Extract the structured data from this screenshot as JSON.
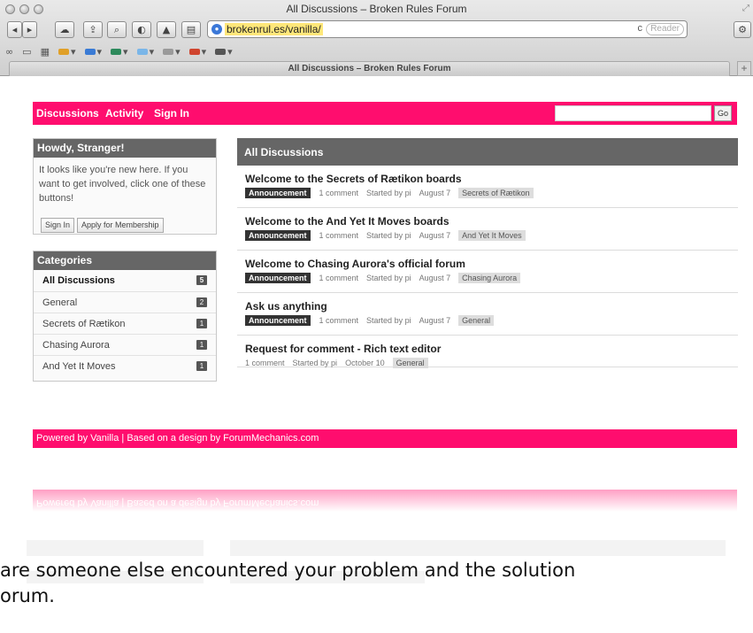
{
  "window": {
    "title": "All Discussions – Broken Rules Forum",
    "tab_title": "All Discussions – Broken Rules Forum",
    "url": "brokenrul.es/vanilla/",
    "reader_label": "Reader",
    "reload_glyph": "c"
  },
  "toolbar": {
    "buttons": [
      "back-icon",
      "forward-icon",
      "icloud-icon",
      "share-icon",
      "zoom-icon",
      "history-icon",
      "alert-icon",
      "sidebar-icon"
    ]
  },
  "bookmarks": {
    "items": [
      {
        "icon": "reading-list-icon",
        "color": "#777777"
      },
      {
        "icon": "book-icon",
        "color": "#777777"
      },
      {
        "icon": "grid-icon",
        "color": "#777777"
      },
      {
        "icon": "folder-icon",
        "color": "#e0a028"
      },
      {
        "icon": "folder-icon",
        "color": "#3a7bd5"
      },
      {
        "icon": "folder-icon",
        "color": "#2d8a5c"
      },
      {
        "icon": "folder-icon",
        "color": "#7ab6e8"
      },
      {
        "icon": "folder-icon",
        "color": "#9a9a9a"
      },
      {
        "icon": "folder-icon",
        "color": "#d0452f"
      },
      {
        "icon": "folder-icon",
        "color": "#555555"
      }
    ]
  },
  "nav": {
    "discussions": "Discussions",
    "activity": "Activity",
    "sign_in": "Sign In",
    "go": "Go",
    "accent": "#ff0d6e"
  },
  "howdy": {
    "heading": "Howdy, Stranger!",
    "text": "It looks like you're new here. If you want to get involved, click one of these buttons!",
    "sign_in": "Sign In",
    "apply": "Apply for Membership"
  },
  "categories": {
    "heading": "Categories",
    "items": [
      {
        "label": "All Discussions",
        "count": "5"
      },
      {
        "label": "General",
        "count": "2"
      },
      {
        "label": "Secrets of Rætikon",
        "count": "1"
      },
      {
        "label": "Chasing Aurora",
        "count": "1"
      },
      {
        "label": "And Yet It Moves",
        "count": "1"
      }
    ]
  },
  "discussions": {
    "heading": "All Discussions",
    "items": [
      {
        "title": "Welcome to the Secrets of Rætikon boards",
        "badge": "Announcement",
        "comments": "1 comment",
        "started": "Started by pi",
        "date": "August 7",
        "category": "Secrets of Rætikon"
      },
      {
        "title": "Welcome to the And Yet It Moves boards",
        "badge": "Announcement",
        "comments": "1 comment",
        "started": "Started by pi",
        "date": "August 7",
        "category": "And Yet It Moves"
      },
      {
        "title": "Welcome to Chasing Aurora's official forum",
        "badge": "Announcement",
        "comments": "1 comment",
        "started": "Started by pi",
        "date": "August 7",
        "category": "Chasing Aurora"
      },
      {
        "title": "Ask us anything",
        "badge": "Announcement",
        "comments": "1 comment",
        "started": "Started by pi",
        "date": "August 7",
        "category": "General"
      },
      {
        "title": "Request for comment - Rich text editor",
        "badge": "",
        "comments": "1 comment",
        "started": "Started by pi",
        "date": "October 10",
        "category": "General"
      }
    ]
  },
  "footer": {
    "text": "Powered by Vanilla  |  Based on a design by ForumMechanics.com"
  },
  "caption": {
    "line1": "are someone else encountered your problem and the solution",
    "line2": "orum."
  }
}
